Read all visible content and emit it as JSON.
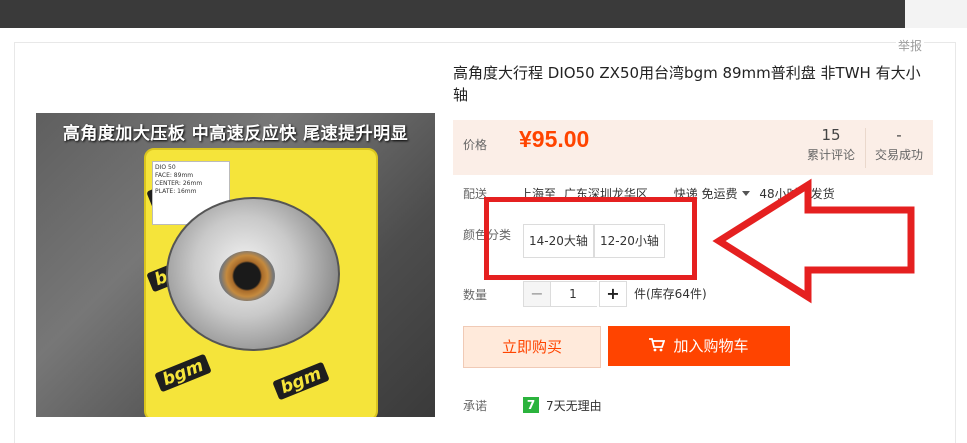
{
  "header": {
    "report_label": "举报"
  },
  "product": {
    "title": "高角度大行程 DIO50 ZX50用台湾bgm 89mm普利盘 非TWH 有大小轴",
    "image": {
      "caption": "高角度加大压板 中高速反应快 尾速提升明显",
      "brand": "bgm",
      "label_lines": [
        "DIO 50",
        "FACE: 89mm",
        "CENTER: 26mm",
        "PLATE: 16mm"
      ]
    }
  },
  "price": {
    "label": "价格",
    "currency": "¥",
    "value": "95.00",
    "reviews_count": "15",
    "reviews_label": "累计评论",
    "deals_count": "-",
    "deals_label": "交易成功"
  },
  "delivery": {
    "label": "配送",
    "from": "上海至",
    "to": "广东深圳龙华区",
    "method": "快递 免运费",
    "ship_time": "48小时内发货"
  },
  "options": {
    "label": "颜色分类",
    "items": [
      "14-20大轴",
      "12-20小轴"
    ]
  },
  "quantity": {
    "label": "数量",
    "minus": "−",
    "value": "1",
    "plus": "+",
    "stock": "件(库存64件)"
  },
  "actions": {
    "buy_now": "立即购买",
    "add_to_cart": "加入购物车"
  },
  "promise": {
    "label": "承诺",
    "badge": "7",
    "text": "7天无理由"
  },
  "annotation": {
    "color": "#e52020"
  },
  "colors": {
    "accent": "#ff4400",
    "price_band": "#fbeee7"
  }
}
